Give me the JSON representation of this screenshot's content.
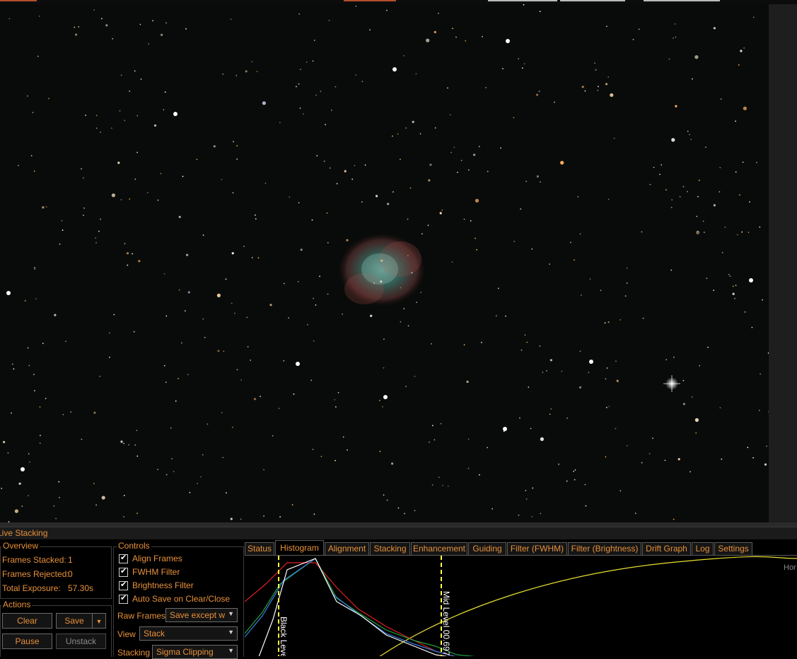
{
  "window": {
    "panel_title": "Live Stacking"
  },
  "overview": {
    "legend": "Overview",
    "frames_stacked_label": "Frames Stacked:",
    "frames_stacked_value": "1",
    "frames_rejected_label": "Frames Rejected:",
    "frames_rejected_value": "0",
    "total_exposure_label": "Total Exposure:",
    "total_exposure_value": "57.30s"
  },
  "actions": {
    "legend": "Actions",
    "clear_label": "Clear",
    "save_label": "Save",
    "pause_label": "Pause",
    "unstack_label": "Unstack"
  },
  "controls": {
    "legend": "Controls",
    "checkboxes": [
      {
        "label": "Align Frames",
        "checked": true
      },
      {
        "label": "FWHM Filter",
        "checked": true
      },
      {
        "label": "Brightness Filter",
        "checked": true
      },
      {
        "label": "Auto Save on Clear/Close",
        "checked": true
      }
    ],
    "raw_frames_label": "Raw Frames",
    "raw_frames_value": "Save except w",
    "view_label": "View",
    "view_value": "Stack",
    "stacking_label": "Stacking",
    "stacking_value": "Sigma Clipping"
  },
  "tabs": [
    {
      "label": "Status",
      "active": false
    },
    {
      "label": "Histogram",
      "active": true
    },
    {
      "label": "Alignment",
      "active": false
    },
    {
      "label": "Stacking",
      "active": false
    },
    {
      "label": "Enhancement",
      "active": false
    },
    {
      "label": "Guiding",
      "active": false
    },
    {
      "label": "Filter (FWHM)",
      "active": false
    },
    {
      "label": "Filter (Brightness)",
      "active": false
    },
    {
      "label": "Drift Graph",
      "active": false
    },
    {
      "label": "Log",
      "active": false
    },
    {
      "label": "Settings",
      "active": false
    }
  ],
  "histogram": {
    "black_level_label": "Black Level",
    "mid_level_label": "Mid Level  00.697",
    "corner_label": "Hor",
    "colors": {
      "red": "#e02020",
      "green": "#20a040",
      "blue": "#3a7ee0",
      "luminance": "#ffffff",
      "curve": "#e8e030",
      "markers": "#ffff40"
    }
  },
  "colors": {
    "accent": "#e8913a",
    "background": "#000000",
    "border": "#3c3c3c"
  }
}
